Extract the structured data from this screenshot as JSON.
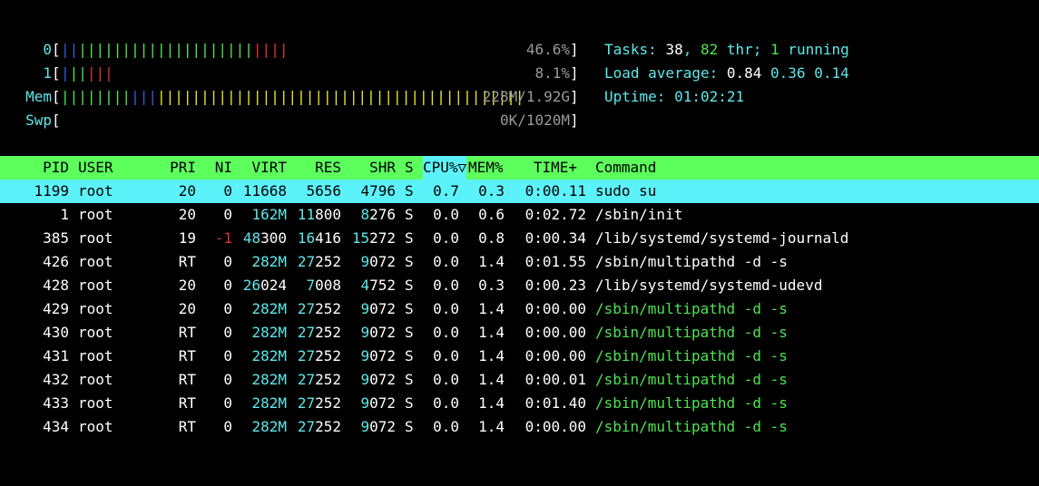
{
  "meters": {
    "cpu0": {
      "label": "0",
      "value": "46.6%",
      "blue": "||",
      "green": "||||||||||||||||||||",
      "red": "||||"
    },
    "cpu1": {
      "label": "1",
      "value": "8.1%",
      "blue": "|",
      "green": "||",
      "red": "|||"
    },
    "mem": {
      "label": "Mem",
      "value": "228M/1.92G",
      "green": "||||||||",
      "blue": "|||",
      "yellow": "||||||||||||||||||||||||||||||||||||||||||"
    },
    "swp": {
      "label": "Swp",
      "value": "0K/1020M"
    }
  },
  "summary": {
    "tasks_label": "Tasks: ",
    "tasks": "38",
    "thr_sep": ", ",
    "thr": "82",
    "thr_label": " thr; ",
    "running": "1",
    "running_label": " running",
    "load_label": "Load average: ",
    "load1": "0.84",
    "load5": "0.36",
    "load15": "0.14",
    "uptime_label": "Uptime: ",
    "uptime": "01:02:21"
  },
  "columns": {
    "pid": "PID",
    "user": "USER",
    "pri": "PRI",
    "ni": "NI",
    "virt": "VIRT",
    "res": "RES",
    "shr": "SHR",
    "s": "S",
    "cpu": "CPU%▽",
    "mem": "MEM%",
    "time": "TIME+",
    "command": "Command"
  },
  "processes": [
    {
      "pid": "1199",
      "user": "root",
      "pri": "20",
      "ni": "0",
      "virt": "11668",
      "res": "5656",
      "shr": "4796",
      "s": "S",
      "cpu": "0.7",
      "mem": "0.3",
      "time": "0:00.11",
      "cmd": "sudo su"
    },
    {
      "pid": "1",
      "user": "root",
      "pri": "20",
      "ni": "0",
      "virt_hi": "162M",
      "virt_lo": "",
      "res_hi": "11",
      "res_lo": "800",
      "shr_hi": "8",
      "shr_lo": "276",
      "s": "S",
      "cpu": "0.0",
      "mem": "0.6",
      "time_hi": "0:02.",
      "time_lo": "72",
      "cmd": "/sbin/init"
    },
    {
      "pid": "385",
      "user": "root",
      "pri": "19",
      "ni": "-1",
      "virt_hi": "48",
      "virt_lo": "300",
      "res_hi": "16",
      "res_lo": "416",
      "shr_hi": "15",
      "shr_lo": "272",
      "s": "S",
      "cpu": "0.0",
      "mem": "0.8",
      "time_hi": "0:00.",
      "time_lo": "34",
      "cmd": "/lib/systemd/systemd-journald"
    },
    {
      "pid": "426",
      "user": "root",
      "pri": "RT",
      "ni": "0",
      "virt_hi": "282M",
      "virt_lo": "",
      "res_hi": "27",
      "res_lo": "252",
      "shr_hi": "9",
      "shr_lo": "072",
      "s": "S",
      "cpu": "0.0",
      "mem": "1.4",
      "time_hi": "0:01.",
      "time_lo": "55",
      "cmd": "/sbin/multipathd -d -s"
    },
    {
      "pid": "428",
      "user": "root",
      "pri": "20",
      "ni": "0",
      "virt_hi": "26",
      "virt_lo": "024",
      "res_hi": "7",
      "res_lo": "008",
      "shr_hi": "4",
      "shr_lo": "752",
      "s": "S",
      "cpu": "0.0",
      "mem": "0.3",
      "time_hi": "0:00.",
      "time_lo": "23",
      "cmd": "/lib/systemd/systemd-udevd"
    },
    {
      "pid": "429",
      "user": "root",
      "pri": "20",
      "ni": "0",
      "virt_hi": "282M",
      "virt_lo": "",
      "res_hi": "27",
      "res_lo": "252",
      "shr_hi": "9",
      "shr_lo": "072",
      "s": "S",
      "cpu": "0.0",
      "mem": "1.4",
      "time_hi": "0:00.",
      "time_lo": "00",
      "cmd": "/sbin/multipathd -d -s",
      "thread": true
    },
    {
      "pid": "430",
      "user": "root",
      "pri": "RT",
      "ni": "0",
      "virt_hi": "282M",
      "virt_lo": "",
      "res_hi": "27",
      "res_lo": "252",
      "shr_hi": "9",
      "shr_lo": "072",
      "s": "S",
      "cpu": "0.0",
      "mem": "1.4",
      "time_hi": "0:00.",
      "time_lo": "00",
      "cmd": "/sbin/multipathd -d -s",
      "thread": true
    },
    {
      "pid": "431",
      "user": "root",
      "pri": "RT",
      "ni": "0",
      "virt_hi": "282M",
      "virt_lo": "",
      "res_hi": "27",
      "res_lo": "252",
      "shr_hi": "9",
      "shr_lo": "072",
      "s": "S",
      "cpu": "0.0",
      "mem": "1.4",
      "time_hi": "0:00.",
      "time_lo": "00",
      "cmd": "/sbin/multipathd -d -s",
      "thread": true
    },
    {
      "pid": "432",
      "user": "root",
      "pri": "RT",
      "ni": "0",
      "virt_hi": "282M",
      "virt_lo": "",
      "res_hi": "27",
      "res_lo": "252",
      "shr_hi": "9",
      "shr_lo": "072",
      "s": "S",
      "cpu": "0.0",
      "mem": "1.4",
      "time_hi": "0:00.",
      "time_lo": "01",
      "cmd": "/sbin/multipathd -d -s",
      "thread": true
    },
    {
      "pid": "433",
      "user": "root",
      "pri": "RT",
      "ni": "0",
      "virt_hi": "282M",
      "virt_lo": "",
      "res_hi": "27",
      "res_lo": "252",
      "shr_hi": "9",
      "shr_lo": "072",
      "s": "S",
      "cpu": "0.0",
      "mem": "1.4",
      "time_hi": "0:01.",
      "time_lo": "40",
      "cmd": "/sbin/multipathd -d -s",
      "thread": true
    },
    {
      "pid": "434",
      "user": "root",
      "pri": "RT",
      "ni": "0",
      "virt_hi": "282M",
      "virt_lo": "",
      "res_hi": "27",
      "res_lo": "252",
      "shr_hi": "9",
      "shr_lo": "072",
      "s": "S",
      "cpu": "0.0",
      "mem": "1.4",
      "time_hi": "0:00.",
      "time_lo": "00",
      "cmd": "/sbin/multipathd -d -s",
      "thread": true
    }
  ],
  "colors": {
    "header_bg": "#5cff5c",
    "selected_bg": "#5cf2f9",
    "meter_blue": "#3b5bdb",
    "meter_green": "#4ee44e",
    "meter_red": "#e03131",
    "meter_yellow": "#e6e62e",
    "cyan": "#5ee8ea"
  }
}
